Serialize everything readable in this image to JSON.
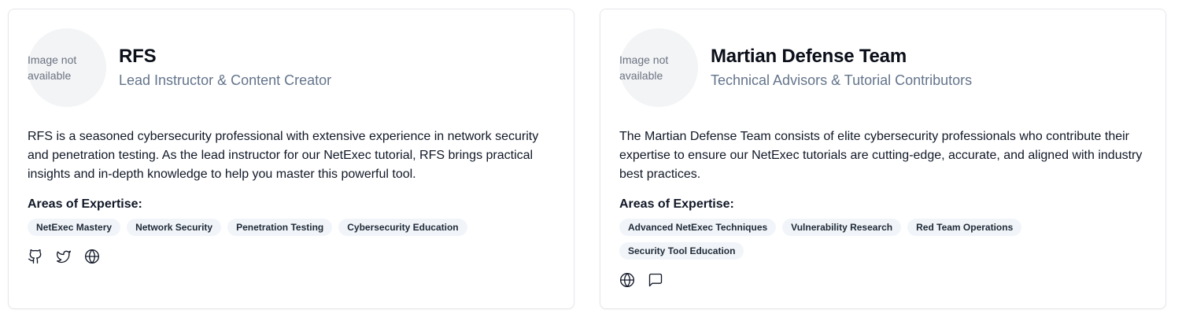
{
  "cards": [
    {
      "avatar_text": "Image not available",
      "name": "RFS",
      "role": "Lead Instructor & Content Creator",
      "bio": "RFS is a seasoned cybersecurity professional with extensive experience in network security and penetration testing. As the lead instructor for our NetExec tutorial, RFS brings practical insights and in-depth knowledge to help you master this powerful tool.",
      "expertise_title": "Areas of Expertise:",
      "tags": [
        "NetExec Mastery",
        "Network Security",
        "Penetration Testing",
        "Cybersecurity Education"
      ],
      "icons": [
        "github-icon",
        "twitter-icon",
        "globe-icon"
      ]
    },
    {
      "avatar_text": "Image not available",
      "name": "Martian Defense Team",
      "role": "Technical Advisors & Tutorial Contributors",
      "bio": "The Martian Defense Team consists of elite cybersecurity professionals who contribute their expertise to ensure our NetExec tutorials are cutting-edge, accurate, and aligned with industry best practices.",
      "expertise_title": "Areas of Expertise:",
      "tags": [
        "Advanced NetExec Techniques",
        "Vulnerability Research",
        "Red Team Operations",
        "Security Tool Education"
      ],
      "icons": [
        "globe-icon",
        "message-icon"
      ]
    }
  ],
  "colors": {
    "border": "#e5e7eb",
    "muted_text": "#64748b",
    "tag_bg": "#f1f5f9",
    "avatar_bg": "#f3f4f6"
  }
}
